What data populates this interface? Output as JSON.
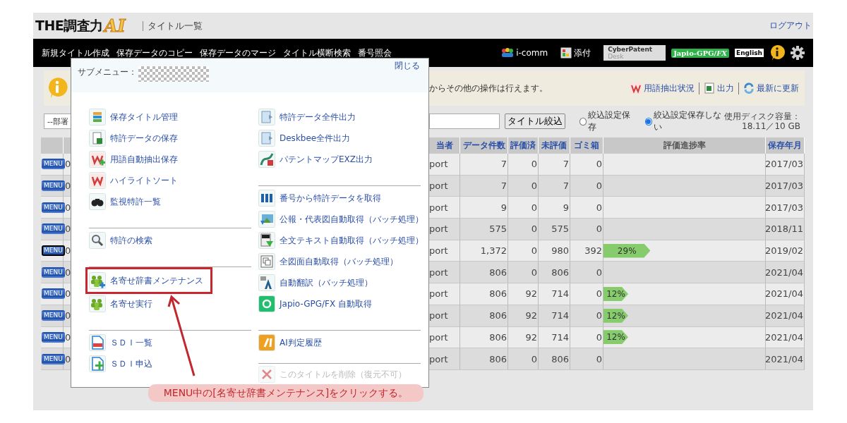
{
  "header": {
    "logo": "THE調査力",
    "logo_mark": "AI",
    "page_title": "タイトル一覧",
    "logout": "ログアウト"
  },
  "nav": {
    "items": [
      "新規タイトル作成",
      "保存データのコピー",
      "保存データのマージ",
      "タイトル横断検索",
      "番号照会"
    ],
    "tools": [
      {
        "kind": "icomm",
        "label": "i-comm"
      },
      {
        "kind": "attach",
        "label": "添付"
      },
      {
        "kind": "cyber",
        "label": "**CyberPatent** Desk"
      },
      {
        "kind": "japio",
        "label": "Japio-GPG/*FX*"
      },
      {
        "kind": "english",
        "label": "English"
      },
      {
        "kind": "info"
      },
      {
        "kind": "settings"
      }
    ]
  },
  "banner": {
    "text": "からその他の操作は行えます。",
    "links": [
      {
        "kind": "terms",
        "label": "用語抽出状況"
      },
      {
        "kind": "excel",
        "label": "出力"
      },
      {
        "kind": "refresh",
        "label": "最新に更新"
      }
    ]
  },
  "filter": {
    "department": "--部署",
    "button": "タイトル絞込",
    "radios": [
      {
        "label": "絞込設定保存",
        "selected": false
      },
      {
        "label": "絞込設定保存しない",
        "selected": true
      }
    ],
    "disk_label": "使用ディスク容量：",
    "disk_value": "18.11／10 GB"
  },
  "table": {
    "columns": [
      "当者",
      "データ件数",
      "評価済",
      "未評価",
      "ゴミ箱",
      "評価進捗率",
      "保存年月"
    ],
    "rows": [
      {
        "menu": "MENU",
        "selected": false,
        "column_2": "0",
        "owner": "port",
        "count": "7",
        "rated": "0",
        "unrated": "7",
        "trash": "0",
        "date": "2017/03"
      },
      {
        "menu": "MENU",
        "selected": false,
        "column_2": "0",
        "owner": "port",
        "count": "7",
        "rated": "0",
        "unrated": "7",
        "trash": "0",
        "date": "2017/03"
      },
      {
        "menu": "MENU",
        "selected": false,
        "column_2": "0",
        "owner": "port",
        "count": "9",
        "rated": "0",
        "unrated": "9",
        "trash": "0",
        "date": "2017/03"
      },
      {
        "menu": "MENU",
        "selected": false,
        "column_2": "0",
        "owner": "port",
        "count": "575",
        "rated": "0",
        "unrated": "575",
        "trash": "0",
        "date": "2018/11"
      },
      {
        "menu": "MENU",
        "selected": true,
        "column_2": "0",
        "owner": "port",
        "count": "1,372",
        "rated": "0",
        "unrated": "980",
        "trash": "392",
        "progress": {
          "level": 0.29,
          "label": "29%"
        },
        "date": "2019/02"
      },
      {
        "menu": "MENU",
        "selected": false,
        "column_2": "0",
        "owner": "port",
        "count": "806",
        "rated": "0",
        "unrated": "806",
        "trash": "0",
        "date": "2021/04"
      },
      {
        "menu": "MENU",
        "selected": false,
        "column_2": "0",
        "owner": "port",
        "count": "806",
        "rated": "92",
        "unrated": "714",
        "trash": "0",
        "progress": {
          "level": 0.12,
          "label": "12%"
        },
        "date": "2021/04"
      },
      {
        "menu": "MENU",
        "selected": false,
        "column_2": "0",
        "owner": "port",
        "count": "806",
        "rated": "92",
        "unrated": "714",
        "trash": "0",
        "progress": {
          "level": 0.12,
          "label": "12%"
        },
        "date": "2021/04"
      },
      {
        "menu": "MENU",
        "selected": false,
        "column_2": "0",
        "owner": "port",
        "count": "806",
        "rated": "92",
        "unrated": "714",
        "trash": "0",
        "progress": {
          "level": 0.12,
          "label": "12%"
        },
        "date": "2021/04"
      },
      {
        "menu": "MENU",
        "selected": false,
        "column_2": "0",
        "owner": "port",
        "count": "806",
        "rated": "0",
        "unrated": "806",
        "trash": "0",
        "date": "2021/04"
      }
    ]
  },
  "submenu": {
    "title": "サブメニュー：",
    "close": "閉じる",
    "columns": [
      [
        [
          {
            "label": "保存タイトル管理"
          },
          {
            "label": "特許データの保存"
          },
          {
            "label": "用語自動抽出保存"
          },
          {
            "label": "ハイライトソート"
          },
          {
            "label": "監視特許一覧"
          }
        ],
        [
          {
            "label": "特許の検索"
          }
        ],
        [
          {
            "label": "名寄せ辞書メンテナンス",
            "highlighted": true
          },
          {
            "label": "名寄せ実行",
            "highlighted": false
          }
        ],
        [
          {
            "label": "ＳＤＩ一覧"
          },
          {
            "label": "ＳＤＩ申込"
          }
        ]
      ],
      [
        [
          {
            "label": "特許データ全件出力"
          },
          {
            "label": "Deskbee全件出力"
          },
          {
            "label": "パテントマップEXZ出力"
          }
        ],
        [
          {
            "label": "番号から特許データを取得"
          },
          {
            "label": "公報・代表図自動取得（バッチ処理）"
          },
          {
            "label": "全文テキスト自動取得（バッチ処理）"
          },
          {
            "label": "全図面自動取得（バッチ処理）"
          },
          {
            "label": "自動翻訳（バッチ処理）"
          },
          {
            "label": "Japio-GPG/FX 自動取得"
          }
        ],
        [
          {
            "label": "AI判定履歴"
          }
        ],
        [
          {
            "label": "このタイトルを削除（復元不可）",
            "disabled": true
          }
        ]
      ]
    ]
  },
  "callout": {
    "text": "MENU中の[名寄せ辞書メンテナンス]をクリックする。"
  }
}
